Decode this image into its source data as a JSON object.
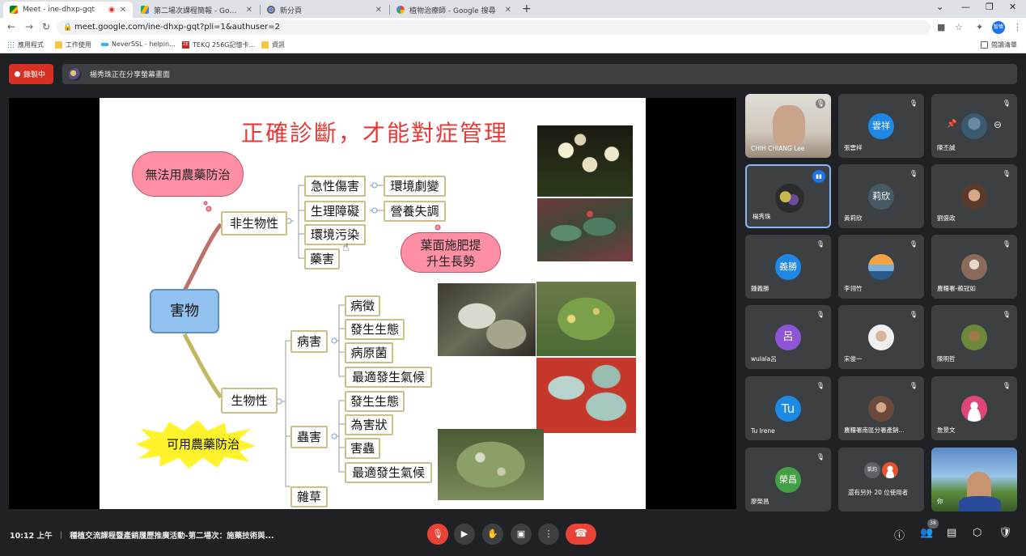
{
  "browser": {
    "tabs": [
      {
        "title": "Meet - ine-dhxp-gqt",
        "active": true
      },
      {
        "title": "第二場次課程簡報 - Google 雲端..."
      },
      {
        "title": "新分頁"
      },
      {
        "title": "植物治療師 - Google 搜尋"
      }
    ],
    "url": "meet.google.com/ine-dhxp-gqt?pli=1&authuser=2",
    "profile_label": "智偉",
    "bookmarks": [
      "應用程式",
      "工作使用",
      "NeverSSL - helpin...",
      "TEKQ 256G記憶卡...",
      "資訊"
    ],
    "bookmark_badge": "ZE",
    "reading_list": "閱讀清單"
  },
  "meet": {
    "recording_label": "錄製中",
    "presenting_label": "楊秀珠正在分享螢幕畫面",
    "slide": {
      "title": "正確診斷，才能對症管理",
      "cloud_left": "無法用農藥防治",
      "cloud_right_line1": "葉面施肥提",
      "cloud_right_line2": "升生長勢",
      "burst": "可用農藥防治",
      "root": "害物",
      "abiotic": "非生物性",
      "abiotic_children": [
        "急性傷害",
        "生理障礙",
        "環境污染",
        "藥害"
      ],
      "acute_child": "環境劇變",
      "physio_child": "營養失調",
      "biotic": "生物性",
      "disease": "病害",
      "disease_children": [
        "病徵",
        "發生生態",
        "病原菌",
        "最適發生氣候"
      ],
      "pest": "蟲害",
      "pest_children": [
        "發生生態",
        "為害狀",
        "害蟲",
        "最適發生氣候"
      ],
      "weed": "雜草"
    },
    "participants": [
      {
        "name": "CHIH CHIANG Lee",
        "type": "video"
      },
      {
        "name": "張雲祥",
        "initials": "雲祥",
        "color": "#1e88e5"
      },
      {
        "name": "陳丕誠",
        "type": "photo"
      },
      {
        "name": "楊秀珠",
        "type": "photo"
      },
      {
        "name": "黃莉欣",
        "initials": "莉欣",
        "color": "#455a64"
      },
      {
        "name": "劉盛政",
        "type": "photo"
      },
      {
        "name": "鍾義勝",
        "initials": "義勝",
        "color": "#1e88e5"
      },
      {
        "name": "李翎竹",
        "type": "photo"
      },
      {
        "name": "農糧署-賴冠如",
        "type": "photo"
      },
      {
        "name": "wulala呂",
        "initials": "呂",
        "color": "#8e55d6"
      },
      {
        "name": "宋俊一",
        "type": "photo"
      },
      {
        "name": "陳明哲",
        "type": "photo"
      },
      {
        "name": "Tu Irene",
        "initials": "Tu",
        "color": "#1e88e5"
      },
      {
        "name": "農糧署南區分署產銷...",
        "type": "photo"
      },
      {
        "name": "詹景文",
        "type": "photo"
      },
      {
        "name": "廖榮昌",
        "initials": "榮昌",
        "color": "#43a047"
      },
      {
        "name": "還有另外 20 位使用者",
        "initials": "凱鈞"
      },
      {
        "name": "你",
        "type": "video"
      }
    ],
    "clock": "10:12 上午",
    "meeting_title": "種植交流課程暨產銷履歷推廣活動-第二場次：施藥技術與...",
    "people_count": "38"
  }
}
